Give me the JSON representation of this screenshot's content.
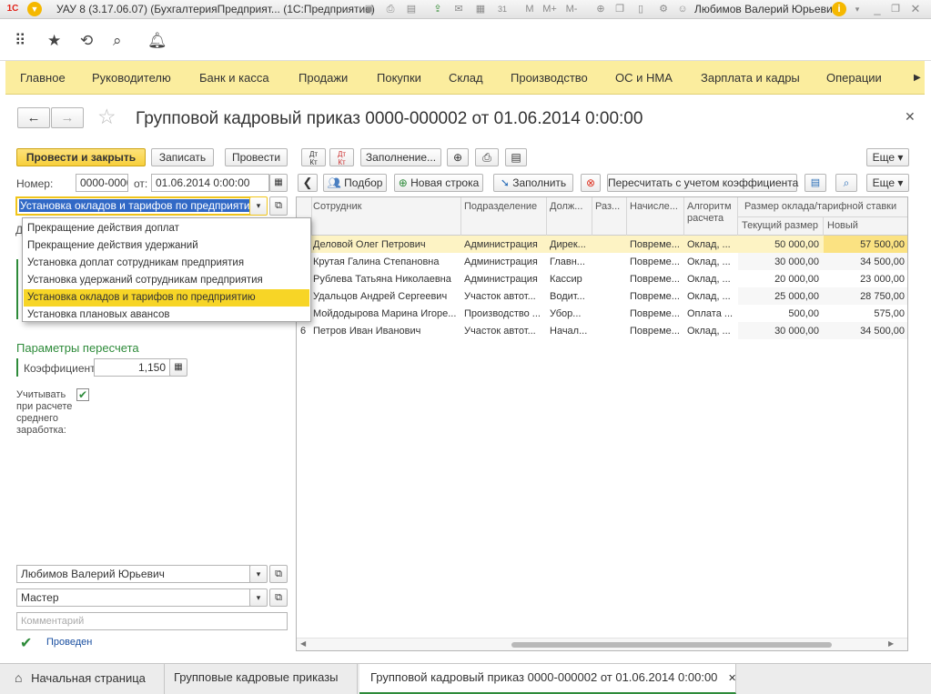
{
  "window": {
    "title": "УАУ 8 (3.17.06.07) (БухгалтерияПредприят... (1С:Предприятие)",
    "user": "Любимов Валерий Юрьевич",
    "toolbar_m": "M",
    "toolbar_mplus": "M+",
    "toolbar_mminus": "M-"
  },
  "menu": [
    "Главное",
    "Руководителю",
    "Банк и касса",
    "Продажи",
    "Покупки",
    "Склад",
    "Производство",
    "ОС и НМА",
    "Зарплата и кадры",
    "Операции"
  ],
  "form": {
    "title": "Групповой кадровый приказ 0000-000002 от 01.06.2014 0:00:00",
    "buttons": {
      "post_close": "Провести и закрыть",
      "save": "Записать",
      "post": "Провести",
      "fill": "Заполнение...",
      "more": "Еще"
    },
    "number_label": "Номер:",
    "number_value": "0000-0000",
    "date_label": "от:",
    "date_value": "01.06.2014 0:00:00",
    "operation_value": "Установка окладов и тарифов по предприятию",
    "dropdown_items": [
      "Прекращение действия доплат",
      "Прекращение действия удержаний",
      "Установка  доплат сотрудникам предприятия",
      "Установка  удержаний сотрудникам предприятия",
      "Установка окладов и тарифов по предприятию",
      "Установка плановых авансов"
    ],
    "recalc_header": "Параметры пересчета",
    "coef_label": "Коэффициент:",
    "coef_value": "1,150",
    "avg_label": "Учитывать при расчете среднего заработка:",
    "responsible": "Любимов Валерий Юрьевич",
    "master": "Мастер",
    "comment_placeholder": "Комментарий",
    "status": "Проведен"
  },
  "grid_toolbar": {
    "select": "Подбор",
    "new_row": "Новая строка",
    "fill": "Заполнить",
    "recalc": "Пересчитать с учетом коэффициента",
    "more": "Еще"
  },
  "grid": {
    "headers": {
      "employee": "Сотрудник",
      "dept": "Подразделение",
      "position": "Долж...",
      "rank": "Раз...",
      "accrual": "Начисле...",
      "algorithm": "Алгоритм расчета",
      "salary_group": "Размер оклада/тарифной ставки",
      "current": "Текущий размер",
      "new": "Новый"
    },
    "rows": [
      {
        "n": "",
        "employee": "Деловой Олег Петрович",
        "dept": "Администрация",
        "position": "Дирек...",
        "accrual": "Повреме...",
        "algorithm": "Оклад, ...",
        "current": "50 000,00",
        "new": "57 500,00"
      },
      {
        "n": "",
        "employee": "Крутая Галина Степановна",
        "dept": "Администрация",
        "position": "Главн...",
        "accrual": "Повреме...",
        "algorithm": "Оклад, ...",
        "current": "30 000,00",
        "new": "34 500,00"
      },
      {
        "n": "",
        "employee": "Рублева Татьяна Николаевна",
        "dept": "Администрация",
        "position": "Кассир",
        "accrual": "Повреме...",
        "algorithm": "Оклад, ...",
        "current": "20 000,00",
        "new": "23 000,00"
      },
      {
        "n": "",
        "employee": "Удальцов Андрей Сергеевич",
        "dept": "Участок автот...",
        "position": "Водит...",
        "accrual": "Повреме...",
        "algorithm": "Оклад, ...",
        "current": "25 000,00",
        "new": "28 750,00"
      },
      {
        "n": "",
        "employee": "Мойдодырова Марина Игоре...",
        "dept": "Производство ...",
        "position": "Убор...",
        "accrual": "Повреме...",
        "algorithm": "Оплата ...",
        "current": "500,00",
        "new": "575,00"
      },
      {
        "n": "6",
        "employee": "Петров Иван Иванович",
        "dept": "Участок автот...",
        "position": "Начал...",
        "accrual": "Повреме...",
        "algorithm": "Оклад, ...",
        "current": "30 000,00",
        "new": "34 500,00"
      }
    ]
  },
  "tabs": [
    "Начальная страница",
    "Групповые кадровые приказы",
    "Групповой кадровый приказ 0000-000002 от 01.06.2014 0:00:00"
  ],
  "colors": {
    "menu_bg": "#fbed9e",
    "accent_yellow": "#f7cf3b",
    "selection": "#fdeb8f",
    "green": "#2e8b3a"
  }
}
